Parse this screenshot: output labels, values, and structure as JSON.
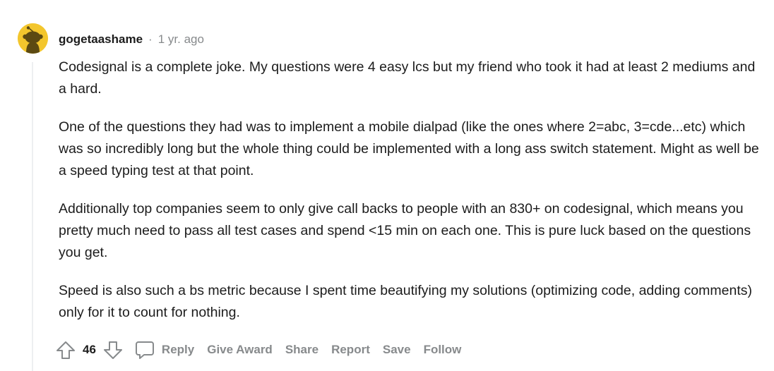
{
  "comment": {
    "author": "gogetaashame",
    "separator": "·",
    "timestamp": "1 yr. ago",
    "avatar_icon": "snoo-avatar-icon",
    "avatar_color": "#f3c62d",
    "paragraphs": [
      "Codesignal is a complete joke. My questions were 4 easy lcs but my friend who took it had at least 2 mediums and a hard.",
      "One of the questions they had was to implement a mobile dialpad (like the ones where 2=abc, 3=cde...etc) which was so incredibly long but the whole thing could be implemented with a long ass switch statement. Might as well be a speed typing test at that point.",
      "Additionally top companies seem to only give call backs to people with an 830+ on codesignal, which means you pretty much need to pass all test cases and spend <15 min on each one. This is pure luck based on the questions you get.",
      "Speed is also such a bs metric because I spent time beautifying my solutions (optimizing code, adding comments) only for it to count for nothing."
    ],
    "vote_count": "46",
    "actions": {
      "reply": "Reply",
      "give_award": "Give Award",
      "share": "Share",
      "report": "Report",
      "save": "Save",
      "follow": "Follow"
    }
  },
  "colors": {
    "text": "#1c1c1c",
    "muted": "#878a8c",
    "thread_line": "#edeff1",
    "avatar_bg": "#f3c62d"
  }
}
